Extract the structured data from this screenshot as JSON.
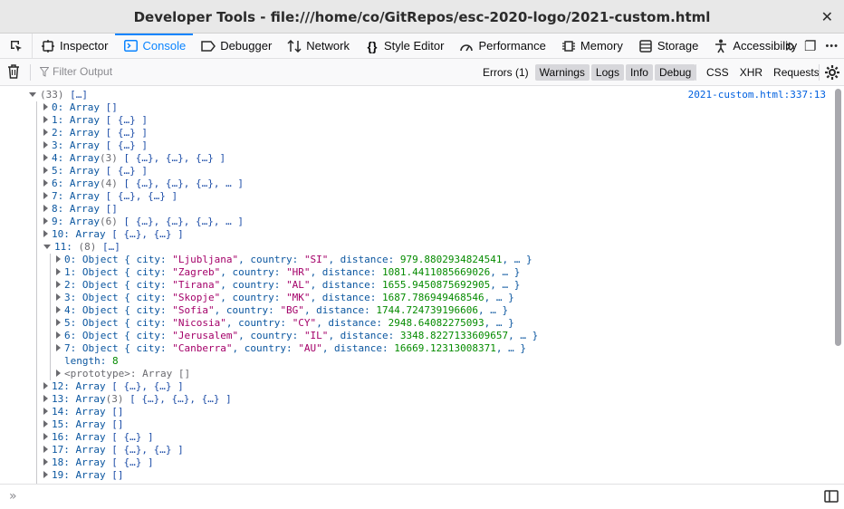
{
  "window": {
    "title": "Developer Tools - file:///home/co/GitRepos/esc-2020-logo/2021-custom.html",
    "close_glyph": "✕"
  },
  "toolbox": {
    "tabs": [
      {
        "label": "Inspector",
        "icon": "inspector-icon"
      },
      {
        "label": "Console",
        "icon": "console-icon",
        "selected": true
      },
      {
        "label": "Debugger",
        "icon": "debugger-icon"
      },
      {
        "label": "Network",
        "icon": "network-icon"
      },
      {
        "label": "Style Editor",
        "icon": "style-editor-icon"
      },
      {
        "label": "Performance",
        "icon": "performance-icon"
      },
      {
        "label": "Memory",
        "icon": "memory-icon"
      },
      {
        "label": "Storage",
        "icon": "storage-icon"
      },
      {
        "label": "Accessibility",
        "icon": "accessibility-icon"
      }
    ],
    "overflow_glyph": "»",
    "dock_glyph": "❐",
    "more_glyph": "•••",
    "accent": "#0a84ff"
  },
  "filterbar": {
    "placeholder": "Filter Output",
    "levels": [
      {
        "label": "Errors (1)",
        "on": false
      },
      {
        "label": "Warnings",
        "on": true
      },
      {
        "label": "Logs",
        "on": true
      },
      {
        "label": "Info",
        "on": true
      },
      {
        "label": "Debug",
        "on": true
      }
    ],
    "net": [
      "CSS",
      "XHR",
      "Requests"
    ]
  },
  "console": {
    "source": "2021-custom.html:337:13",
    "lines": [
      {
        "indent": 0,
        "twisty": "open",
        "segs": [
          [
            "gray",
            "(33) "
          ],
          [
            "punct",
            "[…]"
          ]
        ]
      },
      {
        "indent": 1,
        "twisty": "closed",
        "segs": [
          [
            "k",
            "0: "
          ],
          [
            "k",
            "Array "
          ],
          [
            "punct",
            "[]"
          ]
        ]
      },
      {
        "indent": 1,
        "twisty": "closed",
        "segs": [
          [
            "k",
            "1: "
          ],
          [
            "k",
            "Array "
          ],
          [
            "punct",
            "[ {…} ]"
          ]
        ]
      },
      {
        "indent": 1,
        "twisty": "closed",
        "segs": [
          [
            "k",
            "2: "
          ],
          [
            "k",
            "Array "
          ],
          [
            "punct",
            "[ {…} ]"
          ]
        ]
      },
      {
        "indent": 1,
        "twisty": "closed",
        "segs": [
          [
            "k",
            "3: "
          ],
          [
            "k",
            "Array "
          ],
          [
            "punct",
            "[ {…} ]"
          ]
        ]
      },
      {
        "indent": 1,
        "twisty": "closed",
        "segs": [
          [
            "k",
            "4: "
          ],
          [
            "k",
            "Array"
          ],
          [
            "gray",
            "(3) "
          ],
          [
            "punct",
            "[ {…}, {…}, {…} ]"
          ]
        ]
      },
      {
        "indent": 1,
        "twisty": "closed",
        "segs": [
          [
            "k",
            "5: "
          ],
          [
            "k",
            "Array "
          ],
          [
            "punct",
            "[ {…} ]"
          ]
        ]
      },
      {
        "indent": 1,
        "twisty": "closed",
        "segs": [
          [
            "k",
            "6: "
          ],
          [
            "k",
            "Array"
          ],
          [
            "gray",
            "(4) "
          ],
          [
            "punct",
            "[ {…}, {…}, {…}, … ]"
          ]
        ]
      },
      {
        "indent": 1,
        "twisty": "closed",
        "segs": [
          [
            "k",
            "7: "
          ],
          [
            "k",
            "Array "
          ],
          [
            "punct",
            "[ {…}, {…} ]"
          ]
        ]
      },
      {
        "indent": 1,
        "twisty": "closed",
        "segs": [
          [
            "k",
            "8: "
          ],
          [
            "k",
            "Array "
          ],
          [
            "punct",
            "[]"
          ]
        ]
      },
      {
        "indent": 1,
        "twisty": "closed",
        "segs": [
          [
            "k",
            "9: "
          ],
          [
            "k",
            "Array"
          ],
          [
            "gray",
            "(6) "
          ],
          [
            "punct",
            "[ {…}, {…}, {…}, … ]"
          ]
        ]
      },
      {
        "indent": 1,
        "twisty": "closed",
        "segs": [
          [
            "k",
            "10: "
          ],
          [
            "k",
            "Array "
          ],
          [
            "punct",
            "[ {…}, {…} ]"
          ]
        ]
      },
      {
        "indent": 1,
        "twisty": "open",
        "segs": [
          [
            "k",
            "11: "
          ],
          [
            "gray",
            "(8) "
          ],
          [
            "punct",
            "[…]"
          ]
        ]
      },
      {
        "indent": 2,
        "twisty": "closed",
        "segs": [
          [
            "k",
            "0: "
          ],
          [
            "k",
            "Object { city: "
          ],
          [
            "str",
            "\"Ljubljana\""
          ],
          [
            "k",
            ", country: "
          ],
          [
            "str",
            "\"SI\""
          ],
          [
            "k",
            ", distance: "
          ],
          [
            "num",
            "979.8802934824541"
          ],
          [
            "k",
            ", … }"
          ]
        ]
      },
      {
        "indent": 2,
        "twisty": "closed",
        "segs": [
          [
            "k",
            "1: "
          ],
          [
            "k",
            "Object { city: "
          ],
          [
            "str",
            "\"Zagreb\""
          ],
          [
            "k",
            ", country: "
          ],
          [
            "str",
            "\"HR\""
          ],
          [
            "k",
            ", distance: "
          ],
          [
            "num",
            "1081.4411085669026"
          ],
          [
            "k",
            ", … }"
          ]
        ]
      },
      {
        "indent": 2,
        "twisty": "closed",
        "segs": [
          [
            "k",
            "2: "
          ],
          [
            "k",
            "Object { city: "
          ],
          [
            "str",
            "\"Tirana\""
          ],
          [
            "k",
            ", country: "
          ],
          [
            "str",
            "\"AL\""
          ],
          [
            "k",
            ", distance: "
          ],
          [
            "num",
            "1655.9450875692905"
          ],
          [
            "k",
            ", … }"
          ]
        ]
      },
      {
        "indent": 2,
        "twisty": "closed",
        "segs": [
          [
            "k",
            "3: "
          ],
          [
            "k",
            "Object { city: "
          ],
          [
            "str",
            "\"Skopje\""
          ],
          [
            "k",
            ", country: "
          ],
          [
            "str",
            "\"MK\""
          ],
          [
            "k",
            ", distance: "
          ],
          [
            "num",
            "1687.786949468546"
          ],
          [
            "k",
            ", … }"
          ]
        ]
      },
      {
        "indent": 2,
        "twisty": "closed",
        "segs": [
          [
            "k",
            "4: "
          ],
          [
            "k",
            "Object { city: "
          ],
          [
            "str",
            "\"Sofia\""
          ],
          [
            "k",
            ", country: "
          ],
          [
            "str",
            "\"BG\""
          ],
          [
            "k",
            ", distance: "
          ],
          [
            "num",
            "1744.724739196606"
          ],
          [
            "k",
            ", … }"
          ]
        ]
      },
      {
        "indent": 2,
        "twisty": "closed",
        "segs": [
          [
            "k",
            "5: "
          ],
          [
            "k",
            "Object { city: "
          ],
          [
            "str",
            "\"Nicosia\""
          ],
          [
            "k",
            ", country: "
          ],
          [
            "str",
            "\"CY\""
          ],
          [
            "k",
            ", distance: "
          ],
          [
            "num",
            "2948.64082275093"
          ],
          [
            "k",
            ", … }"
          ]
        ]
      },
      {
        "indent": 2,
        "twisty": "closed",
        "segs": [
          [
            "k",
            "6: "
          ],
          [
            "k",
            "Object { city: "
          ],
          [
            "str",
            "\"Jerusalem\""
          ],
          [
            "k",
            ", country: "
          ],
          [
            "str",
            "\"IL\""
          ],
          [
            "k",
            ", distance: "
          ],
          [
            "num",
            "3348.8227133609657"
          ],
          [
            "k",
            ", … }"
          ]
        ]
      },
      {
        "indent": 2,
        "twisty": "closed",
        "segs": [
          [
            "k",
            "7: "
          ],
          [
            "k",
            "Object { city: "
          ],
          [
            "str",
            "\"Canberra\""
          ],
          [
            "k",
            ", country: "
          ],
          [
            "str",
            "\"AU\""
          ],
          [
            "k",
            ", distance: "
          ],
          [
            "num",
            "16669.12313008371"
          ],
          [
            "k",
            ", … }"
          ]
        ]
      },
      {
        "indent": 2,
        "twisty": "none",
        "segs": [
          [
            "k",
            "length: "
          ],
          [
            "num",
            "8"
          ]
        ]
      },
      {
        "indent": 2,
        "twisty": "closed",
        "segs": [
          [
            "gray",
            "<prototype>: Array []"
          ]
        ]
      },
      {
        "indent": 1,
        "twisty": "closed",
        "segs": [
          [
            "k",
            "12: "
          ],
          [
            "k",
            "Array "
          ],
          [
            "punct",
            "[ {…}, {…} ]"
          ]
        ]
      },
      {
        "indent": 1,
        "twisty": "closed",
        "segs": [
          [
            "k",
            "13: "
          ],
          [
            "k",
            "Array"
          ],
          [
            "gray",
            "(3) "
          ],
          [
            "punct",
            "[ {…}, {…}, {…} ]"
          ]
        ]
      },
      {
        "indent": 1,
        "twisty": "closed",
        "segs": [
          [
            "k",
            "14: "
          ],
          [
            "k",
            "Array "
          ],
          [
            "punct",
            "[]"
          ]
        ]
      },
      {
        "indent": 1,
        "twisty": "closed",
        "segs": [
          [
            "k",
            "15: "
          ],
          [
            "k",
            "Array "
          ],
          [
            "punct",
            "[]"
          ]
        ]
      },
      {
        "indent": 1,
        "twisty": "closed",
        "segs": [
          [
            "k",
            "16: "
          ],
          [
            "k",
            "Array "
          ],
          [
            "punct",
            "[ {…} ]"
          ]
        ]
      },
      {
        "indent": 1,
        "twisty": "closed",
        "segs": [
          [
            "k",
            "17: "
          ],
          [
            "k",
            "Array "
          ],
          [
            "punct",
            "[ {…}, {…} ]"
          ]
        ]
      },
      {
        "indent": 1,
        "twisty": "closed",
        "segs": [
          [
            "k",
            "18: "
          ],
          [
            "k",
            "Array "
          ],
          [
            "punct",
            "[ {…} ]"
          ]
        ]
      },
      {
        "indent": 1,
        "twisty": "closed",
        "segs": [
          [
            "k",
            "19: "
          ],
          [
            "k",
            "Array "
          ],
          [
            "punct",
            "[]"
          ]
        ]
      }
    ]
  },
  "input": {
    "prompt_glyph": "»"
  }
}
